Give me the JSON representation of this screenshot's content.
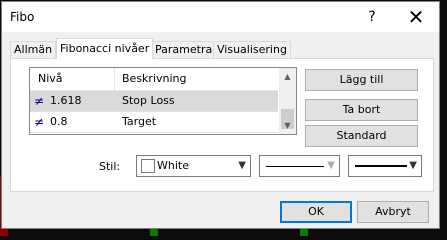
{
  "window": {
    "title": "Fibo",
    "help_glyph": "?",
    "close_glyph": "✕"
  },
  "tabs": [
    {
      "label": "Allmän"
    },
    {
      "label": "Fibonacci nivåer"
    },
    {
      "label": "Parametrar"
    },
    {
      "label": "Visualisering"
    }
  ],
  "list": {
    "headers": {
      "level": "Nivå",
      "description": "Beskrivning"
    },
    "rows": [
      {
        "level": "1.618",
        "description": "Stop Loss",
        "selected": true
      },
      {
        "level": "0.8",
        "description": "Target",
        "selected": false
      }
    ],
    "row_icon": "≠"
  },
  "side_buttons": {
    "add": "Lägg till",
    "remove": "Ta bort",
    "default": "Standard"
  },
  "style": {
    "label": "Stil:",
    "color": "White"
  },
  "footer": {
    "ok": "OK",
    "cancel": "Avbryt"
  },
  "colors": {
    "accent": "#0078d7",
    "selection": "#d9d9d9"
  }
}
